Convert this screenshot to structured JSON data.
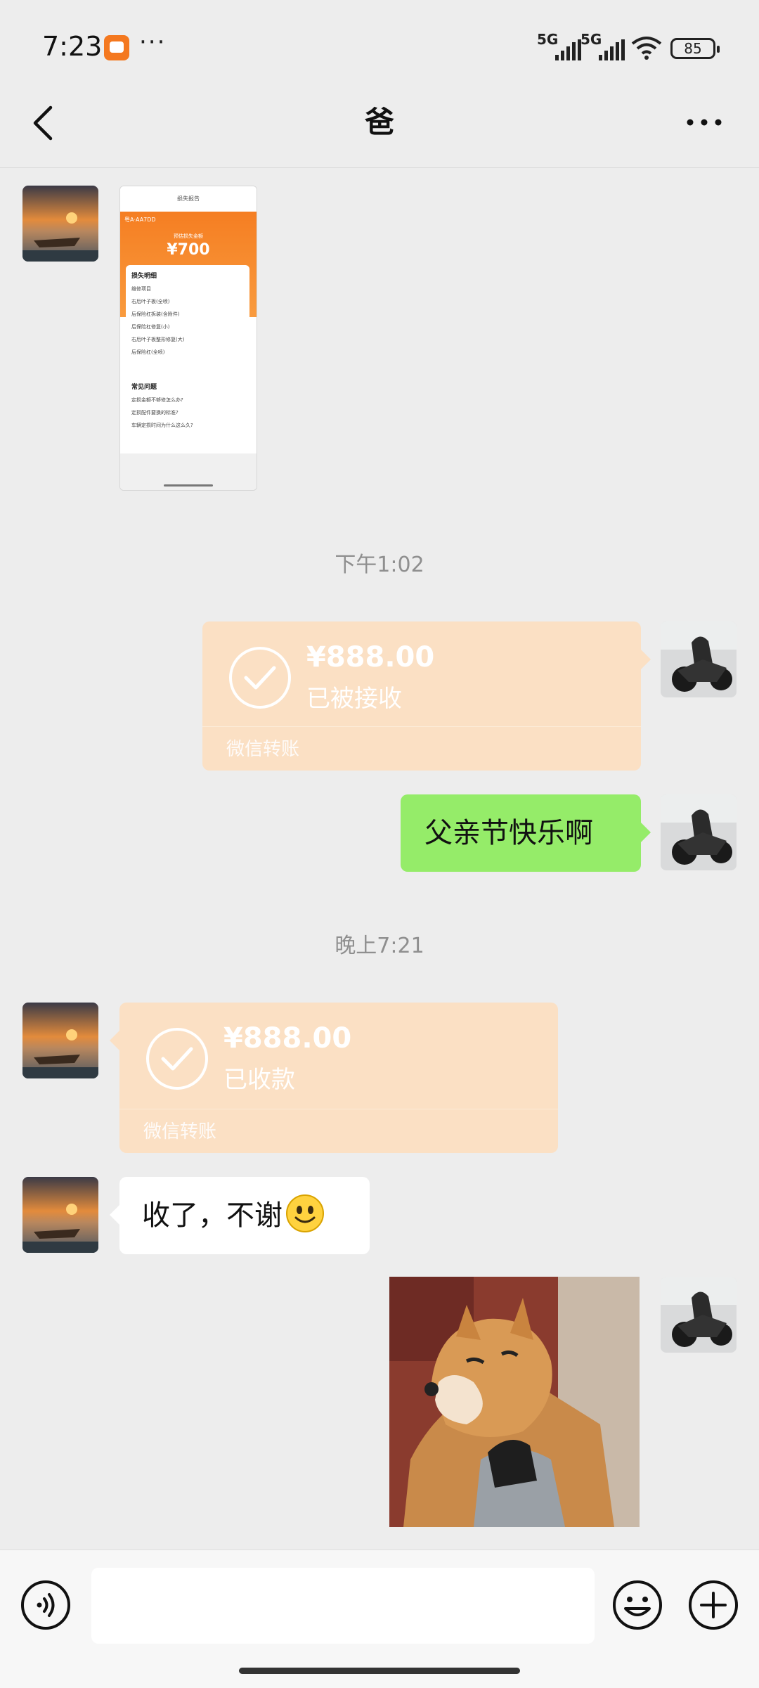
{
  "status_bar": {
    "time": "7:23",
    "app_icon": "didi-orange-icon",
    "dots": "···",
    "sim1": "5G",
    "sim2": "5G",
    "battery": "85"
  },
  "header": {
    "title": "爸",
    "back_icon": "chevron-left-icon",
    "more_icon": "more-dots-icon"
  },
  "screenshot_message": {
    "page_title": "损失报告",
    "plate": "粤A·AA7DD",
    "amount_label": "预估损失金额",
    "amount": "¥700",
    "detail_title": "损失明细",
    "section": "维修项目",
    "items": [
      "右后叶子板(全喷)",
      "后保险杠拆装(含附件)",
      "后保险杠修复(小)",
      "右后叶子板整形修复(大)",
      "后保险杠(全喷)"
    ],
    "faq_title": "常见问题",
    "faq": [
      "定损金额不够修怎么办?",
      "定损配件要换的标准?",
      "车辆定损时间为什么这么久?"
    ]
  },
  "messages": {
    "timestamp1": "下午1:02",
    "transfer_sent": {
      "amount": "¥888.00",
      "status": "已被接收",
      "label": "微信转账"
    },
    "text_sent": "父亲节快乐啊",
    "timestamp2": "晚上7:21",
    "transfer_received": {
      "amount": "¥888.00",
      "status": "已收款",
      "label": "微信转账"
    },
    "text_received": "收了，不谢",
    "sticker": "shiba-dog-sticker"
  },
  "input_bar": {
    "voice_icon": "voice-icon",
    "emoji_icon": "emoji-icon",
    "plus_icon": "plus-icon",
    "input_value": ""
  },
  "colors": {
    "background": "#ededed",
    "transfer_bg": "#fbe0c4",
    "sent_bubble": "#95ec69",
    "received_bubble": "#ffffff",
    "timestamp": "#8f8f8f"
  }
}
